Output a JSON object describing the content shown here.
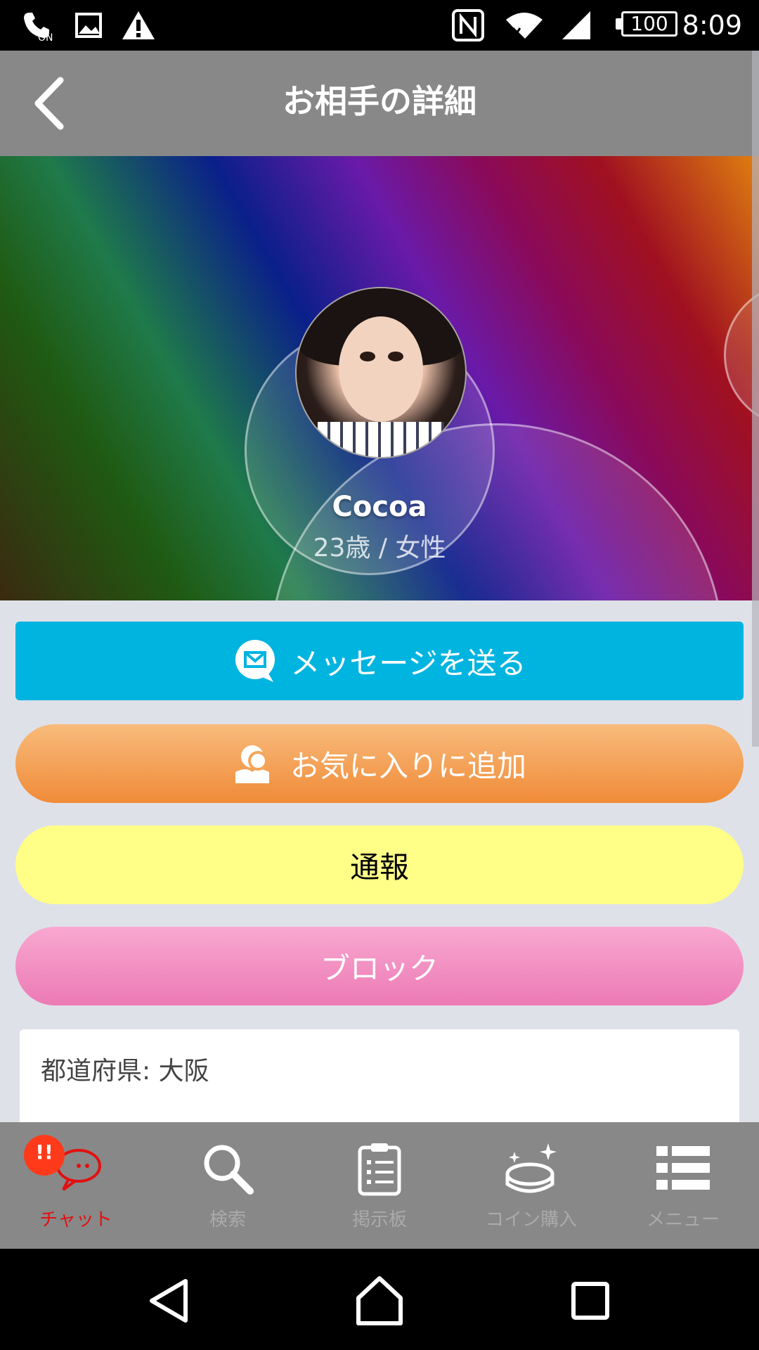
{
  "status_bar": {
    "time": "8:09",
    "battery": "100",
    "icons": [
      "nfc-on-icon",
      "image-icon",
      "warning-icon",
      "nfc-icon",
      "wifi-icon",
      "signal-icon",
      "battery-icon"
    ]
  },
  "header": {
    "title": "お相手の詳細",
    "back_icon": "chevron-left-icon"
  },
  "profile": {
    "name": "Cocoa",
    "age_gender": "23歳 / 女性"
  },
  "actions": {
    "message": "メッセージを送る",
    "favorite": "お気に入りに追加",
    "report": "通報",
    "block": "ブロック"
  },
  "info": {
    "prefecture": "都道府県: 大阪"
  },
  "tabs": [
    {
      "label": "チャット",
      "icon": "chat-icon",
      "badge": "!!"
    },
    {
      "label": "検索",
      "icon": "search-icon"
    },
    {
      "label": "掲示板",
      "icon": "clipboard-icon"
    },
    {
      "label": "コイン購入",
      "icon": "coin-icon"
    },
    {
      "label": "メニュー",
      "icon": "menu-icon"
    }
  ],
  "colors": {
    "header": "#888888",
    "message_button": "#00b4e0",
    "favorite_button": "#f0943f",
    "report_button": "#ffff88",
    "block_button": "#ee82bb",
    "active_tab": "#e21010"
  }
}
